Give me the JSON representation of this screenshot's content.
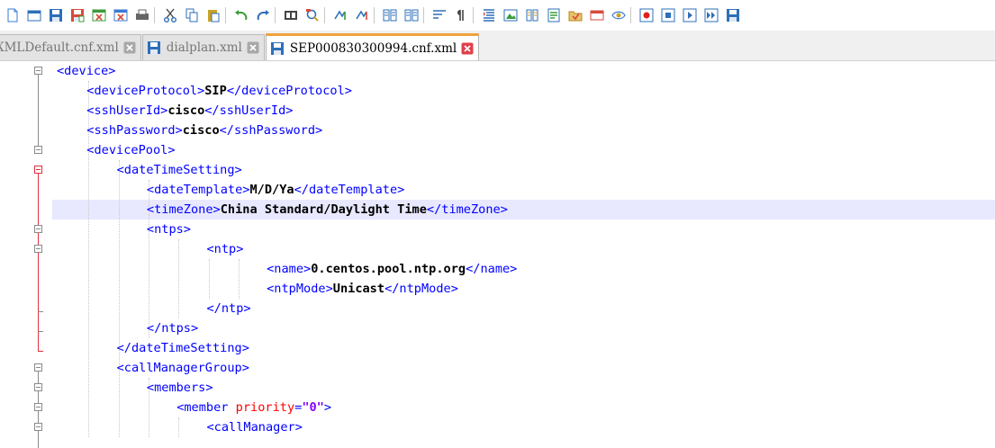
{
  "toolbar": {
    "buttons": [
      {
        "icon": "new-file-icon",
        "color": "#3a7bd5"
      },
      {
        "icon": "open-file-icon",
        "color": "#2d6fb8"
      },
      {
        "icon": "save-icon",
        "color": "#2d6fb8"
      },
      {
        "icon": "save-all-icon",
        "color": "#d64b3a"
      },
      {
        "icon": "close-icon",
        "color": "#3a9b3a"
      },
      {
        "icon": "close-all-icon",
        "color": "#3a7bd5"
      },
      {
        "icon": "print-icon",
        "color": "#444444"
      },
      {
        "sep": true
      },
      {
        "icon": "cut-icon",
        "color": "#2d6fb8"
      },
      {
        "icon": "copy-icon",
        "color": "#2d6fb8"
      },
      {
        "icon": "paste-icon",
        "color": "#c9a227"
      },
      {
        "sep": true
      },
      {
        "icon": "undo-icon",
        "color": "#3a9b3a"
      },
      {
        "icon": "redo-icon",
        "color": "#2d6fb8"
      },
      {
        "sep": true
      },
      {
        "icon": "find-icon",
        "color": "#444444"
      },
      {
        "icon": "replace-icon",
        "color": "#2d6fb8"
      },
      {
        "sep": true
      },
      {
        "icon": "zoom-in-icon",
        "color": "#2d6fb8"
      },
      {
        "icon": "zoom-out-icon",
        "color": "#2d6fb8"
      },
      {
        "sep": true
      },
      {
        "icon": "sync-vertical-icon",
        "color": "#2d6fb8"
      },
      {
        "icon": "sync-horizontal-icon",
        "color": "#2d6fb8"
      },
      {
        "sep": true
      },
      {
        "icon": "word-wrap-icon",
        "color": "#2d6fb8"
      },
      {
        "icon": "show-all-chars-icon",
        "color": "#444444"
      },
      {
        "sep": true
      },
      {
        "icon": "indent-guide-icon",
        "color": "#2d6fb8"
      },
      {
        "icon": "user-language-icon",
        "color": "#3a9b3a"
      },
      {
        "icon": "doc-map-icon",
        "color": "#c9a227"
      },
      {
        "icon": "function-list-icon",
        "color": "#2d6fb8"
      },
      {
        "icon": "folder-workspace-icon",
        "color": "#d64b3a"
      },
      {
        "icon": "monitoring-icon",
        "color": "#d64b3a"
      },
      {
        "icon": "eye-icon",
        "color": "#3a7bd5"
      },
      {
        "sep": true
      },
      {
        "icon": "record-macro-icon",
        "color": "#e02020"
      },
      {
        "icon": "stop-macro-icon",
        "color": "#2d6fb8"
      },
      {
        "icon": "play-macro-icon",
        "color": "#2d6fb8"
      },
      {
        "icon": "run-macro-multiple-icon",
        "color": "#2d6fb8"
      },
      {
        "icon": "save-macro-icon",
        "color": "#2d6fb8"
      }
    ]
  },
  "tabs": [
    {
      "label": "XMLDefault.cnf.xml",
      "active": false,
      "icon_color": "#2d6fb8"
    },
    {
      "label": "dialplan.xml",
      "active": false,
      "icon_color": "#2d6fb8"
    },
    {
      "label": "SEP000830300994.cnf.xml",
      "active": true,
      "icon_color": "#2d6fb8"
    }
  ],
  "colors": {
    "tag": "#0000ff",
    "value": "#000000",
    "attribute": "#ff0000",
    "attribute_value": "#8000ff",
    "current_line": "#e8e8ff",
    "fold_active": "#e0303c",
    "fold_inactive": "#8a8a8a",
    "active_tab_accent": "#f2a33a",
    "tab_close": "#e0404a"
  },
  "editor": {
    "highlight_line": 7,
    "lines": [
      {
        "indent": 0,
        "parts": [
          {
            "t": "tag",
            "s": "<device>"
          }
        ]
      },
      {
        "indent": 1,
        "parts": [
          {
            "t": "tag",
            "s": "<deviceProtocol>"
          },
          {
            "t": "val",
            "s": "SIP"
          },
          {
            "t": "tag",
            "s": "</deviceProtocol>"
          }
        ]
      },
      {
        "indent": 1,
        "parts": [
          {
            "t": "tag",
            "s": "<sshUserId>"
          },
          {
            "t": "val",
            "s": "cisco"
          },
          {
            "t": "tag",
            "s": "</sshUserId>"
          }
        ]
      },
      {
        "indent": 1,
        "parts": [
          {
            "t": "tag",
            "s": "<sshPassword>"
          },
          {
            "t": "val",
            "s": "cisco"
          },
          {
            "t": "tag",
            "s": "</sshPassword>"
          }
        ]
      },
      {
        "indent": 1,
        "parts": [
          {
            "t": "tag",
            "s": "<devicePool>"
          }
        ]
      },
      {
        "indent": 2,
        "parts": [
          {
            "t": "tag",
            "s": "<dateTimeSetting>"
          }
        ]
      },
      {
        "indent": 3,
        "parts": [
          {
            "t": "tag",
            "s": "<dateTemplate>"
          },
          {
            "t": "val",
            "s": "M/D/Ya"
          },
          {
            "t": "tag",
            "s": "</dateTemplate>"
          }
        ]
      },
      {
        "indent": 3,
        "parts": [
          {
            "t": "tag",
            "s": "<timeZone>"
          },
          {
            "t": "val",
            "s": "China Standard/Daylight Time"
          },
          {
            "t": "tag",
            "s": "</timeZone>"
          }
        ]
      },
      {
        "indent": 3,
        "parts": [
          {
            "t": "tag",
            "s": "<ntps>"
          }
        ]
      },
      {
        "indent": 5,
        "parts": [
          {
            "t": "tag",
            "s": "<ntp>"
          }
        ]
      },
      {
        "indent": 7,
        "parts": [
          {
            "t": "tag",
            "s": "<name>"
          },
          {
            "t": "val",
            "s": "0.centos.pool.ntp.org"
          },
          {
            "t": "tag",
            "s": "</name>"
          }
        ]
      },
      {
        "indent": 7,
        "parts": [
          {
            "t": "tag",
            "s": "<ntpMode>"
          },
          {
            "t": "val",
            "s": "Unicast"
          },
          {
            "t": "tag",
            "s": "</ntpMode>"
          }
        ]
      },
      {
        "indent": 5,
        "parts": [
          {
            "t": "tag",
            "s": "</ntp>"
          }
        ]
      },
      {
        "indent": 3,
        "parts": [
          {
            "t": "tag",
            "s": "</ntps>"
          }
        ]
      },
      {
        "indent": 2,
        "parts": [
          {
            "t": "tag",
            "s": "</dateTimeSetting>"
          }
        ]
      },
      {
        "indent": 2,
        "parts": [
          {
            "t": "tag",
            "s": "<callManagerGroup>"
          }
        ]
      },
      {
        "indent": 3,
        "parts": [
          {
            "t": "tag",
            "s": "<members>"
          }
        ]
      },
      {
        "indent": 4,
        "parts": [
          {
            "t": "tag",
            "s": "<member "
          },
          {
            "t": "attr",
            "s": "priority"
          },
          {
            "t": "tag",
            "s": "="
          },
          {
            "t": "aval",
            "s": "\"0\""
          },
          {
            "t": "tag",
            "s": ">"
          }
        ]
      },
      {
        "indent": 5,
        "parts": [
          {
            "t": "tag",
            "s": "<callManager>"
          }
        ]
      }
    ]
  }
}
